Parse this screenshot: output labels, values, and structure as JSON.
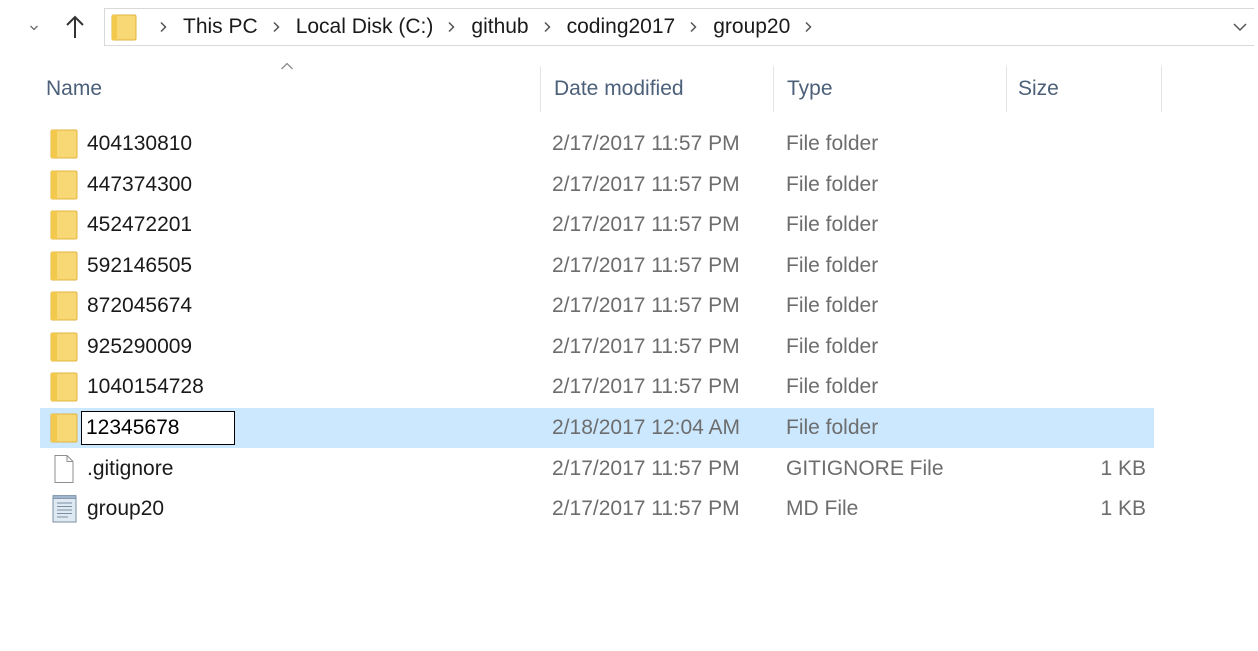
{
  "colors": {
    "selected_row": "#cce8ff",
    "header_text": "#4c607a",
    "secondary_text": "#6d6d6d",
    "folder_fill": "#f8d775",
    "folder_edge": "#e2b43e"
  },
  "address_bar": {
    "back_dropdown_icon": "chevron-down-icon",
    "up_icon": "arrow-up-icon",
    "location_icon": "folder-icon",
    "breadcrumbs": [
      "This PC",
      "Local Disk (C:)",
      "github",
      "coding2017",
      "group20"
    ],
    "history_dropdown_icon": "chevron-down-icon"
  },
  "columns": {
    "name": "Name",
    "date": "Date modified",
    "type": "Type",
    "size": "Size",
    "sort_icon": "sort-ascending-icon"
  },
  "rows": [
    {
      "name": "404130810",
      "date": "2/17/2017 11:57 PM",
      "type": "File folder",
      "size": "",
      "icon": "folder-icon"
    },
    {
      "name": "447374300",
      "date": "2/17/2017 11:57 PM",
      "type": "File folder",
      "size": "",
      "icon": "folder-icon"
    },
    {
      "name": "452472201",
      "date": "2/17/2017 11:57 PM",
      "type": "File folder",
      "size": "",
      "icon": "folder-icon"
    },
    {
      "name": "592146505",
      "date": "2/17/2017 11:57 PM",
      "type": "File folder",
      "size": "",
      "icon": "folder-icon"
    },
    {
      "name": "872045674",
      "date": "2/17/2017 11:57 PM",
      "type": "File folder",
      "size": "",
      "icon": "folder-icon"
    },
    {
      "name": "925290009",
      "date": "2/17/2017 11:57 PM",
      "type": "File folder",
      "size": "",
      "icon": "folder-icon"
    },
    {
      "name": "1040154728",
      "date": "2/17/2017 11:57 PM",
      "type": "File folder",
      "size": "",
      "icon": "folder-icon"
    },
    {
      "name": "12345678",
      "date": "2/18/2017 12:04 AM",
      "type": "File folder",
      "size": "",
      "icon": "folder-icon",
      "selected": true,
      "renaming": true
    },
    {
      "name": ".gitignore",
      "date": "2/17/2017 11:57 PM",
      "type": "GITIGNORE File",
      "size": "1 KB",
      "icon": "blank-file-icon"
    },
    {
      "name": "group20",
      "date": "2/17/2017 11:57 PM",
      "type": "MD File",
      "size": "1 KB",
      "icon": "text-file-icon"
    }
  ]
}
